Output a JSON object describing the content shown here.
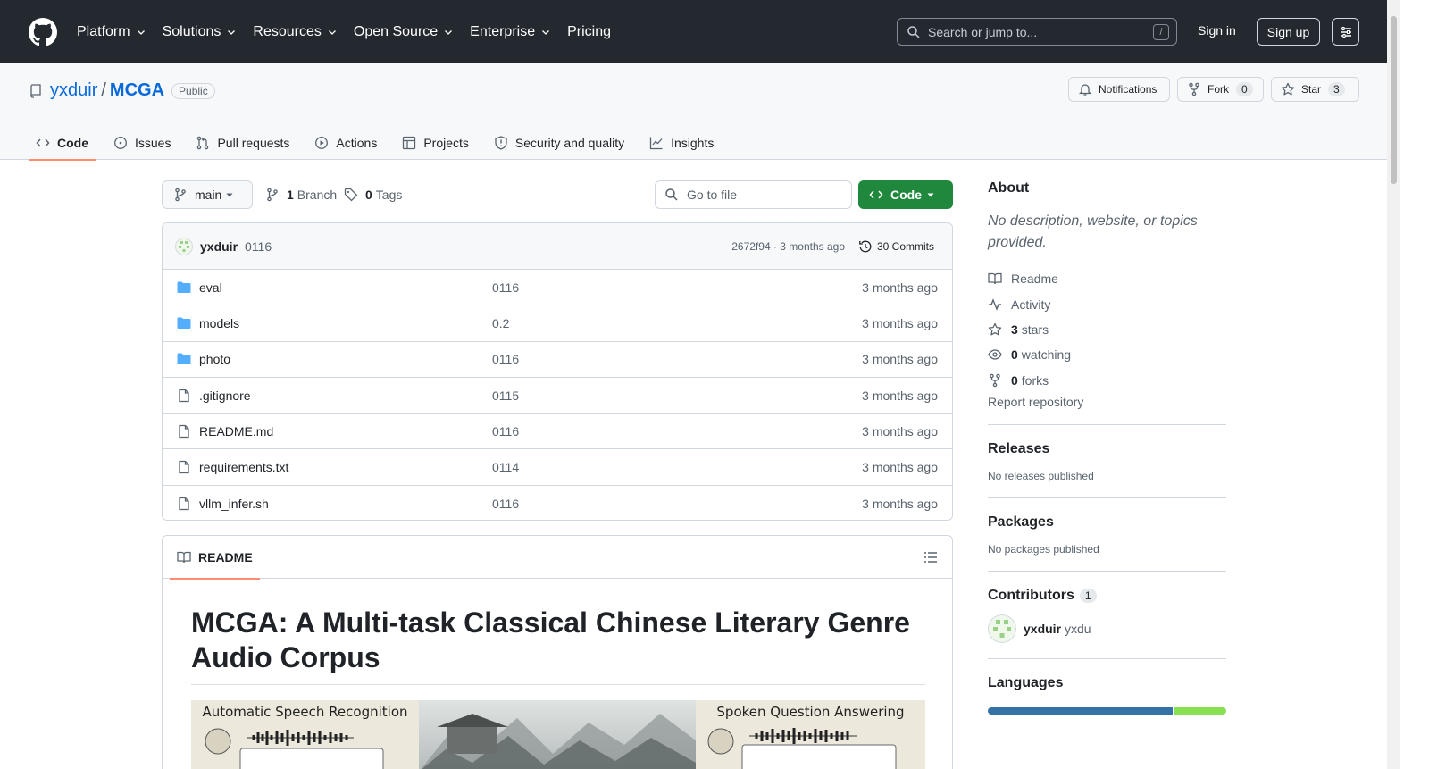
{
  "header": {
    "nav": [
      "Platform",
      "Solutions",
      "Resources",
      "Open Source",
      "Enterprise",
      "Pricing"
    ],
    "search_placeholder": "Search or jump to...",
    "search_shortcut": "/",
    "sign_in": "Sign in",
    "sign_up": "Sign up"
  },
  "repo": {
    "owner": "yxduir",
    "separator": "/",
    "name": "MCGA",
    "visibility": "Public",
    "notifications_label": "Notifications",
    "fork_label": "Fork",
    "fork_count": "0",
    "star_label": "Star",
    "star_count": "3"
  },
  "tabs": [
    "Code",
    "Issues",
    "Pull requests",
    "Actions",
    "Projects",
    "Security and quality",
    "Insights"
  ],
  "toolbar": {
    "branch": "main",
    "branches_count": "1",
    "branches_label": "Branch",
    "tags_count": "0",
    "tags_label": "Tags",
    "goto_file_placeholder": "Go to file",
    "code_button": "Code"
  },
  "commit": {
    "author": "yxduir",
    "message": "0116",
    "hash_time": "2672f94 · 3 months ago",
    "commits_label": "30 Commits"
  },
  "files": [
    {
      "name": "eval",
      "type": "folder",
      "message": "0116",
      "date": "3 months ago"
    },
    {
      "name": "models",
      "type": "folder",
      "message": "0.2",
      "date": "3 months ago"
    },
    {
      "name": "photo",
      "type": "folder",
      "message": "0116",
      "date": "3 months ago"
    },
    {
      "name": ".gitignore",
      "type": "file",
      "message": "0115",
      "date": "3 months ago"
    },
    {
      "name": "README.md",
      "type": "file",
      "message": "0116",
      "date": "3 months ago"
    },
    {
      "name": "requirements.txt",
      "type": "file",
      "message": "0114",
      "date": "3 months ago"
    },
    {
      "name": "vllm_infer.sh",
      "type": "file",
      "message": "0116",
      "date": "3 months ago"
    }
  ],
  "readme": {
    "tab_label": "README",
    "title": "MCGA: A Multi-task Classical Chinese Literary Genre Audio Corpus",
    "banner_left_caption": "Automatic Speech Recognition",
    "banner_right_caption": "Spoken Question Answering"
  },
  "about": {
    "heading": "About",
    "description": "No description, website, or topics provided.",
    "readme_label": "Readme",
    "activity_label": "Activity",
    "stars_count": "3",
    "stars_label": "stars",
    "watching_count": "0",
    "watching_label": "watching",
    "forks_count": "0",
    "forks_label": "forks",
    "report_label": "Report repository"
  },
  "releases": {
    "heading": "Releases",
    "empty": "No releases published"
  },
  "packages": {
    "heading": "Packages",
    "empty": "No packages published"
  },
  "contributors": {
    "heading": "Contributors",
    "count": "1",
    "login": "yxduir",
    "name": "yxdu"
  },
  "languages": {
    "heading": "Languages",
    "segments": [
      {
        "color": "#3572A5",
        "fraction": 0.78
      },
      {
        "color": "#89e051",
        "fraction": 0.22
      }
    ]
  }
}
